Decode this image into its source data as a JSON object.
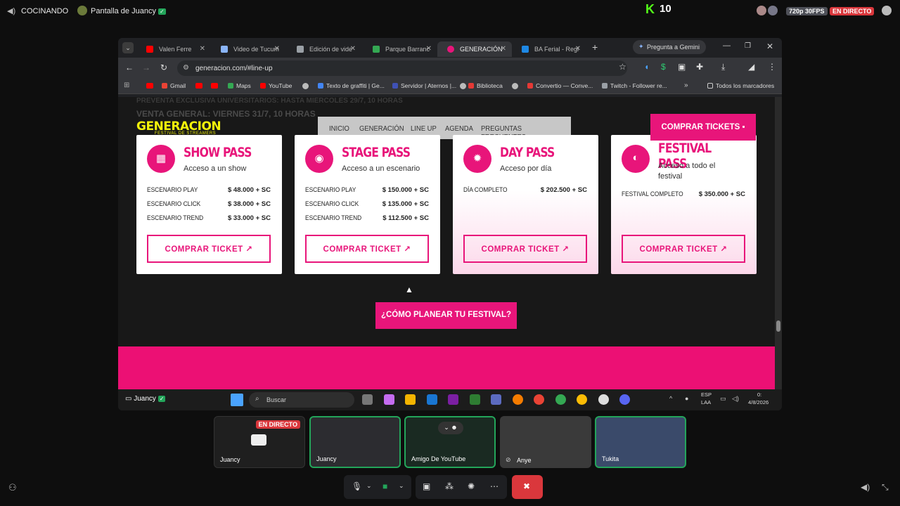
{
  "top": {
    "channel": "COCINANDO",
    "screen": "Pantalla de Juancy",
    "kick_count": "10",
    "quality": "720p 30FPS",
    "live": "EN DIRECTO"
  },
  "browser": {
    "tabs": [
      {
        "label": "Valen Ferre",
        "color": "#ff0000"
      },
      {
        "label": "Video de Tucum",
        "color": "#8ab4f8"
      },
      {
        "label": "Edición de vide",
        "color": "#9aa0a6"
      },
      {
        "label": "Parque Barranc",
        "color": "#34a853"
      },
      {
        "label": "GENERACIÓN",
        "color": "#e8157a"
      },
      {
        "label": "BA Ferial - Regi",
        "color": "#1e88e5"
      }
    ],
    "gemini": "Pregunta a Gemini",
    "url": "generacion.com/#line-up",
    "bookmarks": [
      {
        "label": "Gmail",
        "color": "#ea4335"
      },
      {
        "label": "Maps",
        "color": "#34a853"
      },
      {
        "label": "YouTube",
        "color": "#ff0000"
      },
      {
        "label": "Texto de graffiti | Ge...",
        "color": "#4285f4"
      },
      {
        "label": "Servidor | Aternos |...",
        "color": "#3f51b5"
      },
      {
        "label": "Biblioteca",
        "color": "#e53935"
      },
      {
        "label": "Convertio — Conve...",
        "color": "#e53935"
      },
      {
        "label": "Twitch - Follower re...",
        "color": "#9aa0a6"
      }
    ],
    "all_bookmarks": "Todos los marcadores"
  },
  "site": {
    "logo": "GENERACION",
    "logo_sub": "FESTIVAL DE STREAMERS",
    "faded1": "PREVENTA EXCLUSIVA UNIVERSITARIOS: HASTA MIÉRCOLES 29/7, 10 HORAS",
    "faded2": "VENTA GENERAL: VIERNES 31/7, 10 HORAS",
    "nav": [
      "INICIO",
      "GENERACIÓN",
      "LINE UP",
      "AGENDA",
      "PREGUNTAS FRECUENTES"
    ],
    "buy_label": "COMPRAR TICKETS",
    "cards": [
      {
        "title": "SHOW PASS",
        "sub": "Acceso a un show",
        "rows": [
          [
            "ESCENARIO PLAY",
            "$ 48.000 + SC"
          ],
          [
            "ESCENARIO CLICK",
            "$ 38.000 + SC"
          ],
          [
            "ESCENARIO TREND",
            "$ 33.000 + SC"
          ]
        ],
        "button": "COMPRAR TICKET ↗"
      },
      {
        "title": "STAGE PASS",
        "sub": "Acceso a un escenario",
        "rows": [
          [
            "ESCENARIO PLAY",
            "$ 150.000 + SC"
          ],
          [
            "ESCENARIO CLICK",
            "$ 135.000 + SC"
          ],
          [
            "ESCENARIO TREND",
            "$ 112.500 + SC"
          ]
        ],
        "button": "COMPRAR TICKET ↗"
      },
      {
        "title": "DAY PASS",
        "sub": "Acceso por día",
        "rows": [
          [
            "DÍA COMPLETO",
            "$ 202.500 + SC"
          ]
        ],
        "button": "COMPRAR TICKET ↗"
      },
      {
        "title": "FESTIVAL PASS",
        "sub": "Acceso a todo el festival",
        "rows": [
          [
            "FESTIVAL COMPLETO",
            "$ 350.000 + SC"
          ]
        ],
        "button": "COMPRAR TICKET ↗"
      }
    ],
    "plan_label": "¿CÓMO PLANEAR TU FESTIVAL?"
  },
  "taskbar": {
    "user": "Juancy",
    "search": "Buscar",
    "lang1": "ESP",
    "lang2": "LAA",
    "time": "0:",
    "date": "4/8/2026"
  },
  "participants": [
    {
      "name": "Juancy",
      "live": "EN DIRECTO"
    },
    {
      "name": "Juancy"
    },
    {
      "name": "Amigo De YouTube"
    },
    {
      "name": "Anye"
    },
    {
      "name": "Tukita"
    }
  ]
}
